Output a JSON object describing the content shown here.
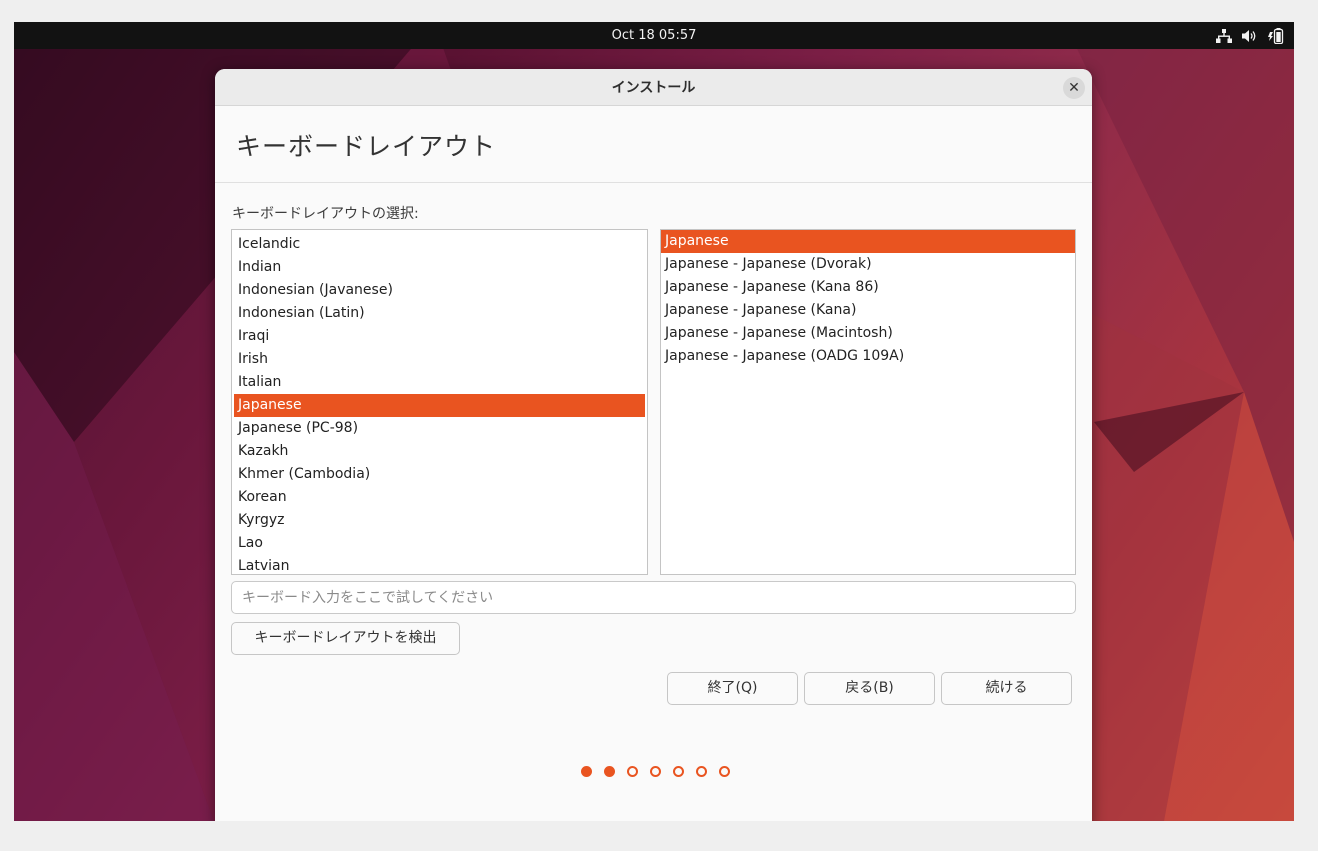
{
  "topbar": {
    "clock": "Oct 18  05:57"
  },
  "window": {
    "title": "インストール",
    "close_symbol": "✕"
  },
  "page": {
    "heading": "キーボードレイアウト",
    "select_label": "キーボードレイアウトの選択:"
  },
  "layouts": {
    "items": [
      "Icelandic",
      "Indian",
      "Indonesian (Javanese)",
      "Indonesian (Latin)",
      "Iraqi",
      "Irish",
      "Italian",
      "Japanese",
      "Japanese (PC-98)",
      "Kazakh",
      "Khmer (Cambodia)",
      "Korean",
      "Kyrgyz",
      "Lao",
      "Latvian"
    ],
    "selected_index": 7
  },
  "variants": {
    "items": [
      "Japanese",
      "Japanese - Japanese (Dvorak)",
      "Japanese - Japanese (Kana 86)",
      "Japanese - Japanese (Kana)",
      "Japanese - Japanese (Macintosh)",
      "Japanese - Japanese (OADG 109A)"
    ],
    "selected_index": 0
  },
  "test_input": {
    "placeholder": "キーボード入力をここで試してください",
    "value": ""
  },
  "buttons": {
    "detect": "キーボードレイアウトを検出",
    "quit": "終了(Q)",
    "back": "戻る(B)",
    "continue": "続ける"
  },
  "progress": {
    "total_steps": 7,
    "completed_steps": 2
  },
  "icons": {
    "network": "network-icon",
    "volume": "volume-icon",
    "battery": "battery-icon"
  },
  "colors": {
    "accent": "#e95420",
    "topbar": "#121212"
  }
}
